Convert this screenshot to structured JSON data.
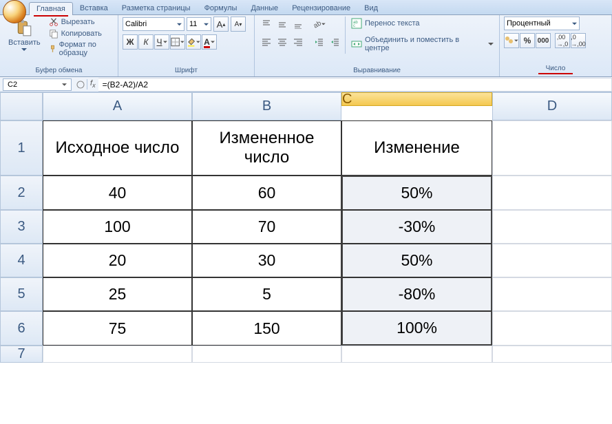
{
  "tabs": [
    "Главная",
    "Вставка",
    "Разметка страницы",
    "Формулы",
    "Данные",
    "Рецензирование",
    "Вид"
  ],
  "active_tab": 0,
  "clipboard": {
    "paste": "Вставить",
    "cut": "Вырезать",
    "copy": "Копировать",
    "format": "Формат по образцу",
    "title": "Буфер обмена"
  },
  "font": {
    "name": "Calibri",
    "size": "11",
    "title": "Шрифт"
  },
  "align": {
    "wrap": "Перенос текста",
    "merge": "Объединить и поместить в центре",
    "title": "Выравнивание"
  },
  "number": {
    "format": "Процентный",
    "title": "Число"
  },
  "formula_bar": {
    "name_box": "C2",
    "formula": "=(B2-A2)/A2"
  },
  "columns": [
    "A",
    "B",
    "C",
    "D"
  ],
  "rows": [
    "1",
    "2",
    "3",
    "4",
    "5",
    "6",
    "7"
  ],
  "headers": [
    "Исходное число",
    "Измененное число",
    "Изменение"
  ],
  "data": [
    [
      "40",
      "60",
      "50%"
    ],
    [
      "100",
      "70",
      "-30%"
    ],
    [
      "20",
      "30",
      "50%"
    ],
    [
      "25",
      "5",
      "-80%"
    ],
    [
      "75",
      "150",
      "100%"
    ]
  ],
  "selected_column": 2
}
